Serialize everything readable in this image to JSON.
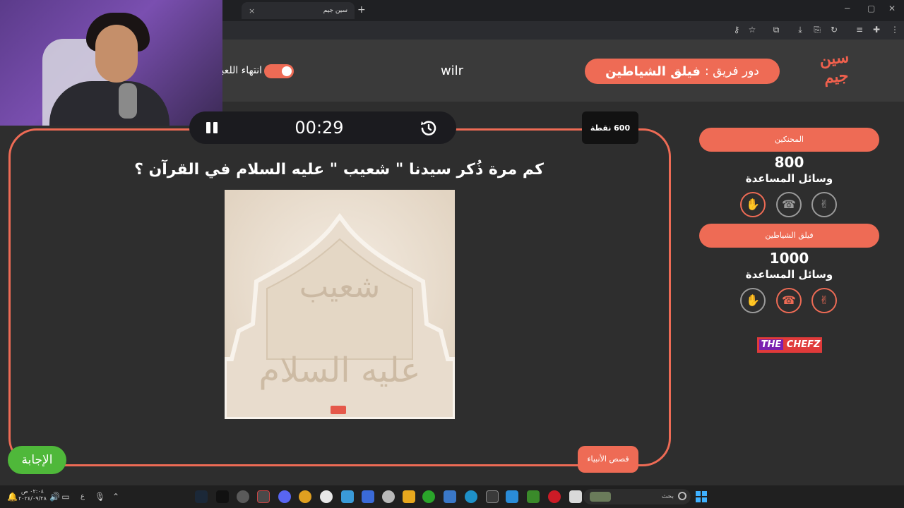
{
  "browser": {
    "tab_title": "سين جيم",
    "tab_close": "×",
    "new_tab": "+",
    "window_controls": [
      "─",
      "▢",
      "✕"
    ]
  },
  "header": {
    "logo_text": "سين جيم",
    "turn_prefix": "دور فريق :",
    "turn_team": "فيلق الشياطين",
    "username": "wilr",
    "end_game_label": "انتهاء اللعبة"
  },
  "game": {
    "timer": "00:29",
    "points": "600 نقطة",
    "question": "كم مرة ذُكر سيدنا \" شعيب \" عليه السلام في القرآن ؟",
    "image_text_top": "شعيب",
    "image_text_bottom": "عليه السلام",
    "answer_button": "الإجابة",
    "category": "قصص الأنبياء"
  },
  "teams": [
    {
      "name": "المحنكين",
      "score": "800",
      "help_label": "وسائل المساعدة",
      "lifelines": [
        {
          "icon": "hand-icon",
          "active": true
        },
        {
          "icon": "phone-icon",
          "active": false
        },
        {
          "icon": "peace-icon",
          "active": false
        }
      ]
    },
    {
      "name": "فيلق الشياطين",
      "score": "1000",
      "help_label": "وسائل المساعدة",
      "lifelines": [
        {
          "icon": "hand-icon",
          "active": false
        },
        {
          "icon": "phone-icon",
          "active": true
        },
        {
          "icon": "peace-icon",
          "active": true
        }
      ]
    }
  ],
  "sponsor": {
    "the": "THE",
    "name": "CHEFZ"
  },
  "taskbar": {
    "search_placeholder": "بحث",
    "clock_time": "٠٢:٠٤ ص",
    "clock_date": "٢٠٢٤/٠٩/٢٨",
    "lang": "ع"
  },
  "colors": {
    "accent": "#ee6b55",
    "answer": "#4fb83a",
    "background": "#2e2e2e"
  }
}
